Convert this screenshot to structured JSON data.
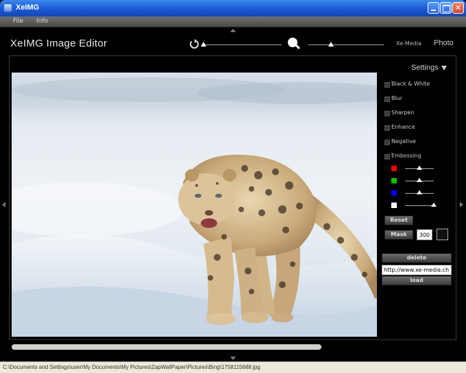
{
  "window": {
    "title": "XeIMG",
    "controls": {
      "minimize": "",
      "maximize": "",
      "close": "✕"
    }
  },
  "menu": {
    "file": "File",
    "info": "Info"
  },
  "header": {
    "app_title": "XeIMG Image Editor",
    "brand": "Xe-Media",
    "mode": "Photo",
    "rotate_slider_value": 0,
    "zoom_slider_value": 0.3
  },
  "settings": {
    "title": "Settings",
    "options": [
      {
        "label": "Black & White",
        "checked": false
      },
      {
        "label": "Blur",
        "checked": false
      },
      {
        "label": "Sharpen",
        "checked": false
      },
      {
        "label": "Enhance",
        "checked": false
      },
      {
        "label": "Negative",
        "checked": false
      },
      {
        "label": "Embossing",
        "checked": false
      }
    ],
    "channels": [
      {
        "name": "red",
        "color": "#ff0000",
        "value": 0.5
      },
      {
        "name": "green",
        "color": "#00c000",
        "value": 0.5
      },
      {
        "name": "blue",
        "color": "#0000ff",
        "value": 0.5
      },
      {
        "name": "white",
        "color": "#ffffff",
        "value": 1.0
      }
    ],
    "reset_label": "Reset",
    "mask_label": "Mask",
    "mask_value": "300",
    "mask_color": "#111111"
  },
  "actions": {
    "delete_label": "delete",
    "url_value": "http://www.xe-media.ch",
    "load_label": "load"
  },
  "status": {
    "path": "C:\\Documents and Settings\\user\\My Documents\\My Pictures\\ZapWallPaper\\Pictures\\Bing\\1758115688.jpg"
  }
}
